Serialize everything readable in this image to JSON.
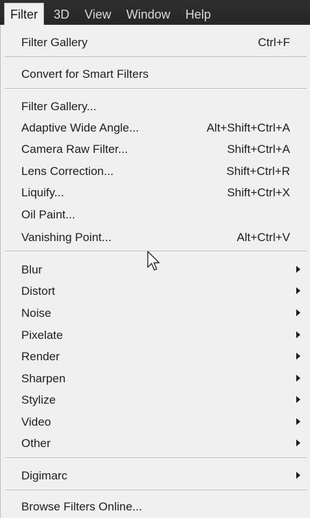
{
  "menubar": {
    "items": [
      {
        "label": "Filter",
        "active": true
      },
      {
        "label": "3D",
        "active": false
      },
      {
        "label": "View",
        "active": false
      },
      {
        "label": "Window",
        "active": false
      },
      {
        "label": "Help",
        "active": false
      }
    ]
  },
  "filter_menu": {
    "filter_gallery_recent": {
      "label": "Filter Gallery",
      "shortcut": "Ctrl+F"
    },
    "convert_smart": {
      "label": "Convert for Smart Filters"
    },
    "filter_gallery": {
      "label": "Filter Gallery...",
      "shortcut": ""
    },
    "adaptive_wide_angle": {
      "label": "Adaptive Wide Angle...",
      "shortcut": "Alt+Shift+Ctrl+A"
    },
    "camera_raw": {
      "label": "Camera Raw Filter...",
      "shortcut": "Shift+Ctrl+A"
    },
    "lens_correction": {
      "label": "Lens Correction...",
      "shortcut": "Shift+Ctrl+R"
    },
    "liquify": {
      "label": "Liquify...",
      "shortcut": "Shift+Ctrl+X"
    },
    "oil_paint": {
      "label": "Oil Paint...",
      "shortcut": ""
    },
    "vanishing_point": {
      "label": "Vanishing Point...",
      "shortcut": "Alt+Ctrl+V"
    },
    "submenus": [
      {
        "label": "Blur"
      },
      {
        "label": "Distort"
      },
      {
        "label": "Noise"
      },
      {
        "label": "Pixelate"
      },
      {
        "label": "Render"
      },
      {
        "label": "Sharpen"
      },
      {
        "label": "Stylize"
      },
      {
        "label": "Video"
      },
      {
        "label": "Other"
      }
    ],
    "digimarc": {
      "label": "Digimarc"
    },
    "browse_online": {
      "label": "Browse Filters Online..."
    }
  },
  "icons": {
    "cursor": "arrow-cursor-icon",
    "submenu_arrow": "chevron-right-icon"
  },
  "colors": {
    "menubar_bg": "#2b2b2b",
    "menu_bg": "#f0f0f0",
    "menu_text": "#1e1e1e",
    "menubar_text": "#d9d9d9"
  }
}
